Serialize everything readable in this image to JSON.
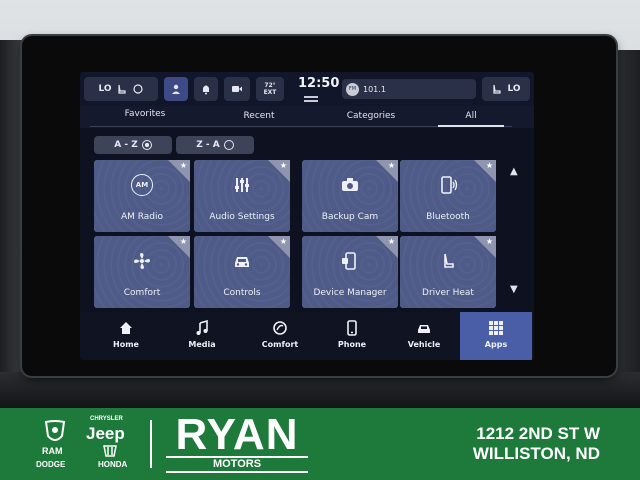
{
  "status_bar": {
    "left_temp": "LO",
    "time": "12:50",
    "outside_temp_value": "72°",
    "outside_temp_label": "EXT",
    "radio_station": "101.1",
    "right_temp": "LO"
  },
  "tabs": [
    {
      "label": "Favorites"
    },
    {
      "label": "Recent"
    },
    {
      "label": "Categories"
    },
    {
      "label": "All",
      "active": true
    }
  ],
  "sort": {
    "az_label": "A - Z",
    "za_label": "Z - A",
    "selected": "A - Z"
  },
  "apps": [
    {
      "label": "AM Radio",
      "icon": "am-radio-icon",
      "icon_text": "AM",
      "favorite": false
    },
    {
      "label": "Audio Settings",
      "icon": "equalizer-icon",
      "favorite": false
    },
    {
      "label": "Backup Cam",
      "icon": "camera-icon",
      "favorite": false
    },
    {
      "label": "Bluetooth",
      "icon": "bluetooth-phone-icon",
      "favorite": false
    },
    {
      "label": "Comfort",
      "icon": "fan-icon",
      "favorite": false
    },
    {
      "label": "Controls",
      "icon": "car-icon",
      "favorite": false
    },
    {
      "label": "Device Manager",
      "icon": "device-icon",
      "favorite": true
    },
    {
      "label": "Driver Heat",
      "icon": "seat-heat-icon",
      "favorite": false
    }
  ],
  "nav": [
    {
      "label": "Home",
      "icon": "home-icon"
    },
    {
      "label": "Media",
      "icon": "music-note-icon"
    },
    {
      "label": "Comfort",
      "icon": "climate-icon"
    },
    {
      "label": "Phone",
      "icon": "phone-icon"
    },
    {
      "label": "Vehicle",
      "icon": "vehicle-icon"
    },
    {
      "label": "Apps",
      "icon": "apps-grid-icon",
      "active": true
    }
  ],
  "banner": {
    "brand_chrysler": "CHRYSLER",
    "brand_jeep": "Jeep",
    "brand_ram": "RAM",
    "brand_dodge": "DODGE",
    "brand_honda": "HONDA",
    "dealer_name": "RYAN",
    "dealer_sub": "MOTORS",
    "address_line1": "1212 2ND ST W",
    "address_line2": "WILLISTON, ND"
  },
  "colors": {
    "tile": "#4e5a87",
    "active_nav": "#4a5ea7",
    "banner": "#1d7a3a"
  }
}
